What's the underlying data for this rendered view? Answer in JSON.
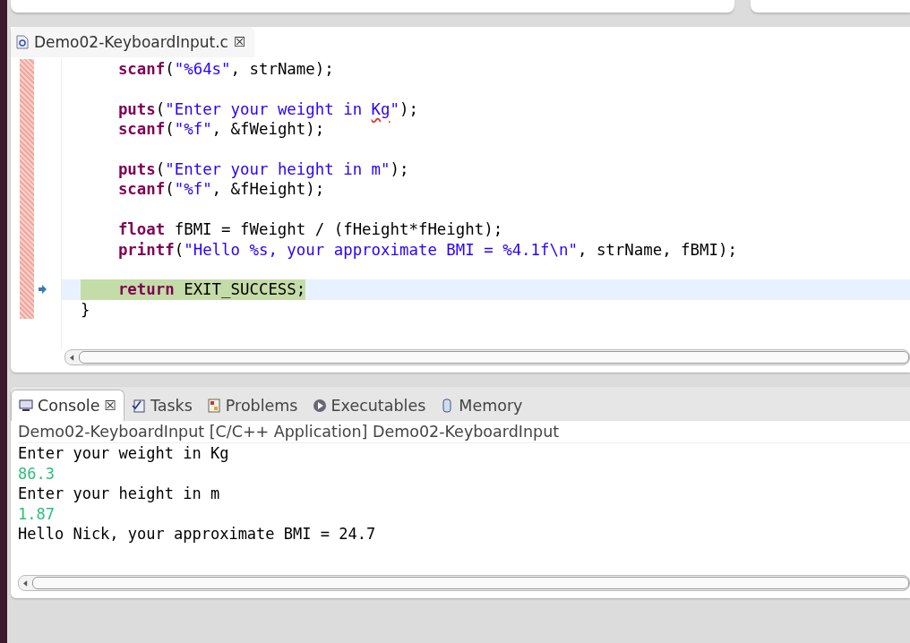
{
  "editor": {
    "tabs": [
      {
        "label": "Demo02-KeyboardInput.c",
        "close": "☒",
        "selected": true
      }
    ],
    "lines": [
      {
        "kind": "code",
        "current": false,
        "segments": [
          {
            "kind": "keyword",
            "text": "    scanf"
          },
          {
            "kind": "plain",
            "text": "("
          },
          {
            "kind": "string",
            "text": "\"%64s\""
          },
          {
            "kind": "plain",
            "text": ", strName);"
          }
        ]
      },
      {
        "kind": "blank"
      },
      {
        "kind": "code",
        "current": false,
        "segments": [
          {
            "kind": "keyword",
            "text": "    puts"
          },
          {
            "kind": "plain",
            "text": "("
          },
          {
            "kind": "string",
            "text": "\"Enter your weight in "
          },
          {
            "kind": "string",
            "text": "Kg",
            "misspelled": true
          },
          {
            "kind": "string",
            "text": "\""
          },
          {
            "kind": "plain",
            "text": ");"
          }
        ]
      },
      {
        "kind": "code",
        "current": false,
        "segments": [
          {
            "kind": "keyword",
            "text": "    scanf"
          },
          {
            "kind": "plain",
            "text": "("
          },
          {
            "kind": "string",
            "text": "\"%f\""
          },
          {
            "kind": "plain",
            "text": ", &fWeight);"
          }
        ]
      },
      {
        "kind": "blank"
      },
      {
        "kind": "code",
        "current": false,
        "segments": [
          {
            "kind": "keyword",
            "text": "    puts"
          },
          {
            "kind": "plain",
            "text": "("
          },
          {
            "kind": "string",
            "text": "\"Enter your height in m\""
          },
          {
            "kind": "plain",
            "text": ");"
          }
        ]
      },
      {
        "kind": "code",
        "current": false,
        "segments": [
          {
            "kind": "keyword",
            "text": "    scanf"
          },
          {
            "kind": "plain",
            "text": "("
          },
          {
            "kind": "string",
            "text": "\"%f\""
          },
          {
            "kind": "plain",
            "text": ", &fHeight);"
          }
        ]
      },
      {
        "kind": "blank"
      },
      {
        "kind": "code",
        "current": false,
        "segments": [
          {
            "kind": "keyword",
            "text": "    float"
          },
          {
            "kind": "plain",
            "text": " fBMI = fWeight / (fHeight*fHeight);"
          }
        ]
      },
      {
        "kind": "code",
        "current": false,
        "segments": [
          {
            "kind": "keyword",
            "text": "    printf"
          },
          {
            "kind": "plain",
            "text": "("
          },
          {
            "kind": "string",
            "text": "\"Hello %s, your approximate BMI = %4.1f\\n\""
          },
          {
            "kind": "plain",
            "text": ", strName, fBMI);"
          }
        ]
      },
      {
        "kind": "blank"
      },
      {
        "kind": "code",
        "current": true,
        "segments": [
          {
            "kind": "keyword",
            "text": "    return"
          },
          {
            "kind": "plain",
            "text": " EXIT_SUCCESS;"
          }
        ]
      },
      {
        "kind": "code",
        "current": false,
        "segments": [
          {
            "kind": "plain",
            "text": "}"
          }
        ]
      }
    ]
  },
  "console": {
    "tabs": [
      {
        "label": "Console",
        "kind": "console",
        "close": "☒",
        "selected": true
      },
      {
        "label": "Tasks",
        "kind": "tasks",
        "selected": false
      },
      {
        "label": "Problems",
        "kind": "problems",
        "selected": false
      },
      {
        "label": "Executables",
        "kind": "executables",
        "selected": false
      },
      {
        "label": "Memory",
        "kind": "memory",
        "selected": false
      }
    ],
    "header": "Demo02-KeyboardInput [C/C++ Application] Demo02-KeyboardInput",
    "lines": [
      {
        "kind": "output",
        "text": "Enter your weight in Kg"
      },
      {
        "kind": "input",
        "text": "86.3"
      },
      {
        "kind": "output",
        "text": "Enter your height in m"
      },
      {
        "kind": "input",
        "text": "1.87"
      },
      {
        "kind": "output",
        "text": "Hello Nick, your approximate BMI = 24.7"
      }
    ]
  }
}
